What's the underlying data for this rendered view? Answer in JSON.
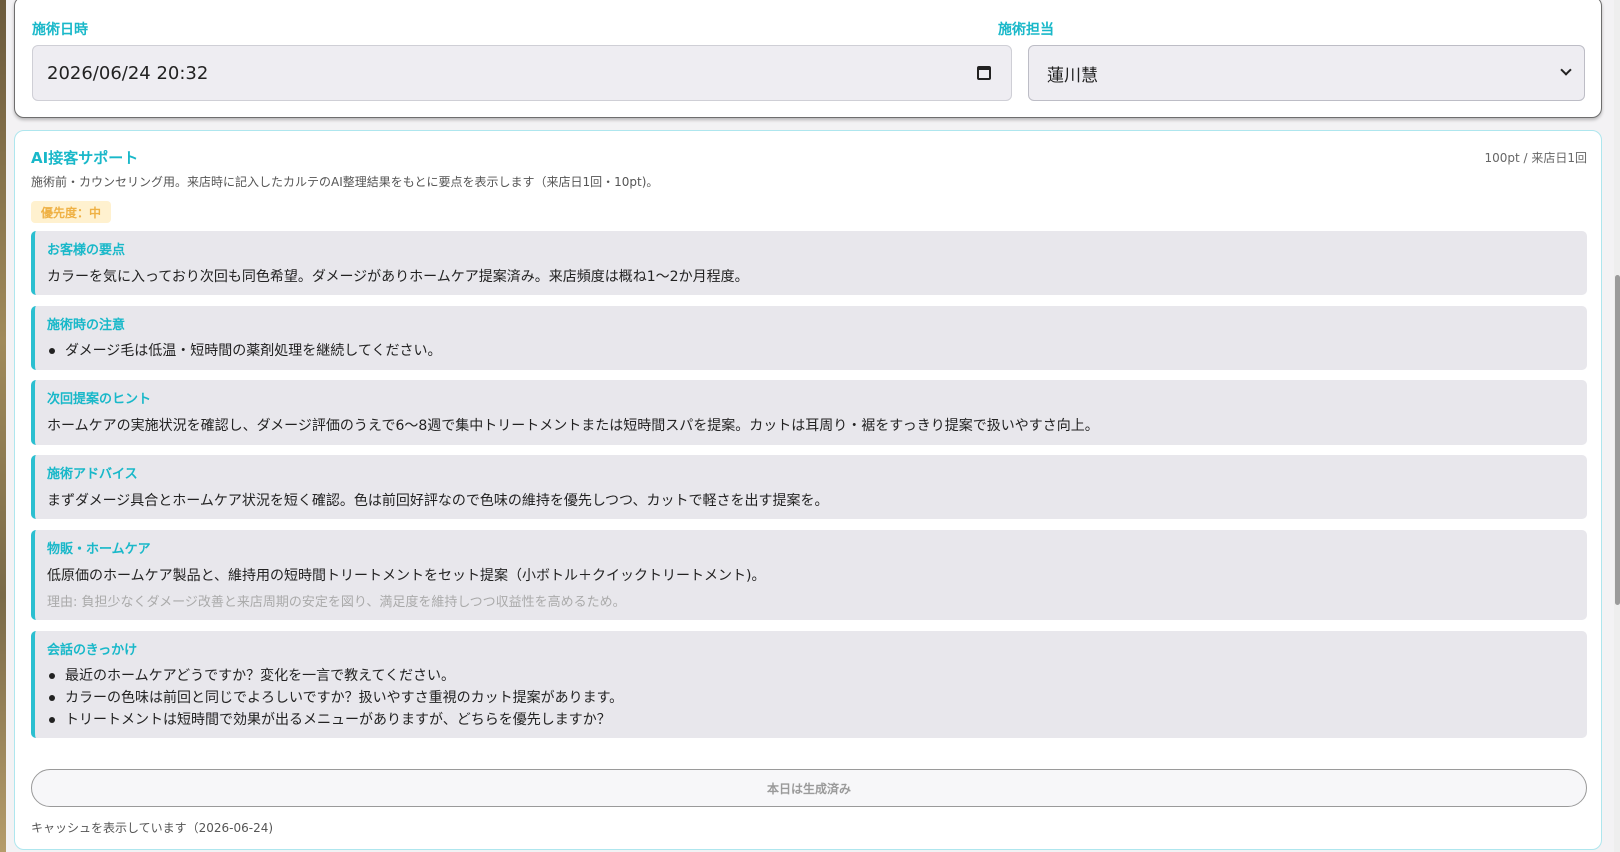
{
  "form": {
    "date_label": "施術日時",
    "date_value": "2026/06/24 20:32",
    "staff_label": "施術担当",
    "staff_value": "蓮川慧"
  },
  "ai": {
    "title": "AI接客サポート",
    "price": "100pt / 来店日1回",
    "description": "施術前・カウンセリング用。来店時に記入したカルテのAI整理結果をもとに要点を表示します（来店日1回・10pt)。",
    "priority": "優先度：中",
    "sections": [
      {
        "title": "お客様の要点",
        "body": "カラーを気に入っており次回も同色希望。ダメージがありホームケア提案済み。来店頻度は概ね1〜2か月程度。"
      },
      {
        "title": "施術時の注意",
        "bullets": [
          "ダメージ毛は低温・短時間の薬剤処理を継続してください。"
        ]
      },
      {
        "title": "次回提案のヒント",
        "body": "ホームケアの実施状況を確認し、ダメージ評価のうえで6〜8週で集中トリートメントまたは短時間スパを提案。カットは耳周り・裾をすっきり提案で扱いやすさ向上。"
      },
      {
        "title": "施術アドバイス",
        "body": "まずダメージ具合とホームケア状況を短く確認。色は前回好評なので色味の維持を優先しつつ、カットで軽さを出す提案を。"
      },
      {
        "title": "物販・ホームケア",
        "body": "低原価のホームケア製品と、維持用の短時間トリートメントをセット提案（小ボトル＋クイックトリートメント)。",
        "reason": "理由: 負担少なくダメージ改善と来店周期の安定を図り、満足度を維持しつつ収益性を高めるため。"
      },
      {
        "title": "会話のきっかけ",
        "bullets": [
          "最近のホームケアどうですか？変化を一言で教えてください。",
          "カラーの色味は前回と同じでよろしいですか？扱いやすさ重視のカット提案があります。",
          "トリートメントは短時間で効果が出るメニューがありますが、どちらを優先しますか？"
        ]
      }
    ],
    "button_label": "本日は生成済み",
    "cache_note": "キャッシュを表示しています（2026-06-24)"
  },
  "colors": {
    "accent": "#19b8c9",
    "priority_bg": "#fff1cf",
    "priority_text": "#efb145",
    "section_bg": "#e8e7ec"
  }
}
